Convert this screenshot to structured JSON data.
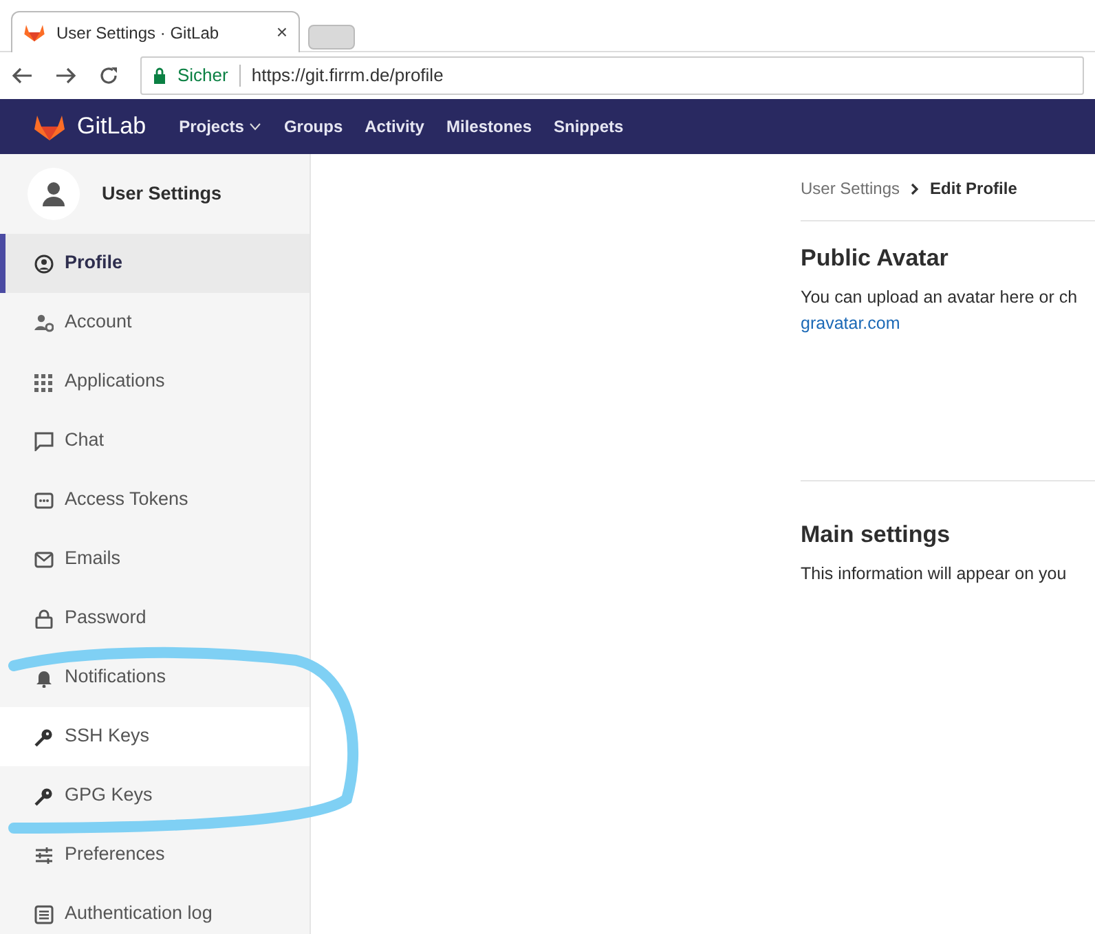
{
  "browser": {
    "tab_title": "User Settings · GitLab",
    "tab_close": "×",
    "security_label": "Sicher",
    "url": "https://git.firrm.de/profile"
  },
  "navbar": {
    "brand": "GitLab",
    "links": [
      {
        "label": "Projects",
        "dropdown": true
      },
      {
        "label": "Groups",
        "dropdown": false
      },
      {
        "label": "Activity",
        "dropdown": false
      },
      {
        "label": "Milestones",
        "dropdown": false
      },
      {
        "label": "Snippets",
        "dropdown": false
      }
    ]
  },
  "sidebar": {
    "title": "User Settings",
    "items": [
      {
        "label": "Profile",
        "selected": true,
        "hovered": false
      },
      {
        "label": "Account",
        "selected": false,
        "hovered": false
      },
      {
        "label": "Applications",
        "selected": false,
        "hovered": false
      },
      {
        "label": "Chat",
        "selected": false,
        "hovered": false
      },
      {
        "label": "Access Tokens",
        "selected": false,
        "hovered": false
      },
      {
        "label": "Emails",
        "selected": false,
        "hovered": false
      },
      {
        "label": "Password",
        "selected": false,
        "hovered": false
      },
      {
        "label": "Notifications",
        "selected": false,
        "hovered": false
      },
      {
        "label": "SSH Keys",
        "selected": false,
        "hovered": true
      },
      {
        "label": "GPG Keys",
        "selected": false,
        "hovered": false
      },
      {
        "label": "Preferences",
        "selected": false,
        "hovered": false
      },
      {
        "label": "Authentication log",
        "selected": false,
        "hovered": false
      }
    ]
  },
  "breadcrumb": [
    {
      "label": "User Settings",
      "current": false
    },
    {
      "label": "Edit Profile",
      "current": true
    }
  ],
  "sections": [
    {
      "title": "Public Avatar",
      "text": "You can upload an avatar here or ch",
      "link": "gravatar.com"
    },
    {
      "title": "Main settings",
      "text": "This information will appear on you"
    }
  ]
}
